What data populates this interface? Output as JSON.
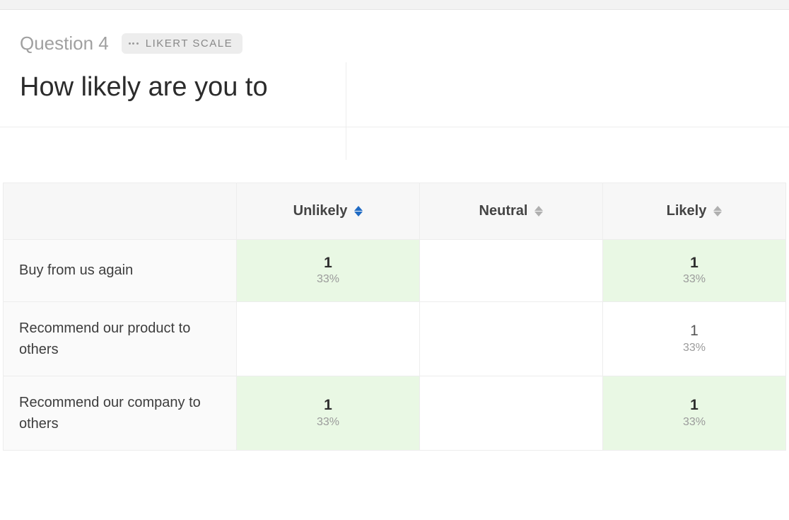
{
  "header": {
    "question_label": "Question 4",
    "badge_text": "LIKERT SCALE",
    "title": "How likely are you to"
  },
  "table": {
    "columns": [
      {
        "label": "Unlikely",
        "sort_active": true
      },
      {
        "label": "Neutral",
        "sort_active": false
      },
      {
        "label": "Likely",
        "sort_active": false
      }
    ],
    "rows": [
      {
        "label": "Buy from us again",
        "cells": [
          {
            "count": "1",
            "pct": "33%",
            "highlight": true,
            "bold": true
          },
          {
            "count": "",
            "pct": "",
            "highlight": false,
            "bold": false
          },
          {
            "count": "1",
            "pct": "33%",
            "highlight": true,
            "bold": true
          }
        ]
      },
      {
        "label": "Recommend our product to others",
        "cells": [
          {
            "count": "",
            "pct": "",
            "highlight": false,
            "bold": false
          },
          {
            "count": "",
            "pct": "",
            "highlight": false,
            "bold": false
          },
          {
            "count": "1",
            "pct": "33%",
            "highlight": false,
            "bold": false
          }
        ]
      },
      {
        "label": "Recommend our company to others",
        "cells": [
          {
            "count": "1",
            "pct": "33%",
            "highlight": true,
            "bold": true
          },
          {
            "count": "",
            "pct": "",
            "highlight": false,
            "bold": false
          },
          {
            "count": "1",
            "pct": "33%",
            "highlight": true,
            "bold": true
          }
        ]
      }
    ]
  },
  "colors": {
    "sort_active": "#206bc4",
    "sort_inactive": "#b0b0b0"
  }
}
